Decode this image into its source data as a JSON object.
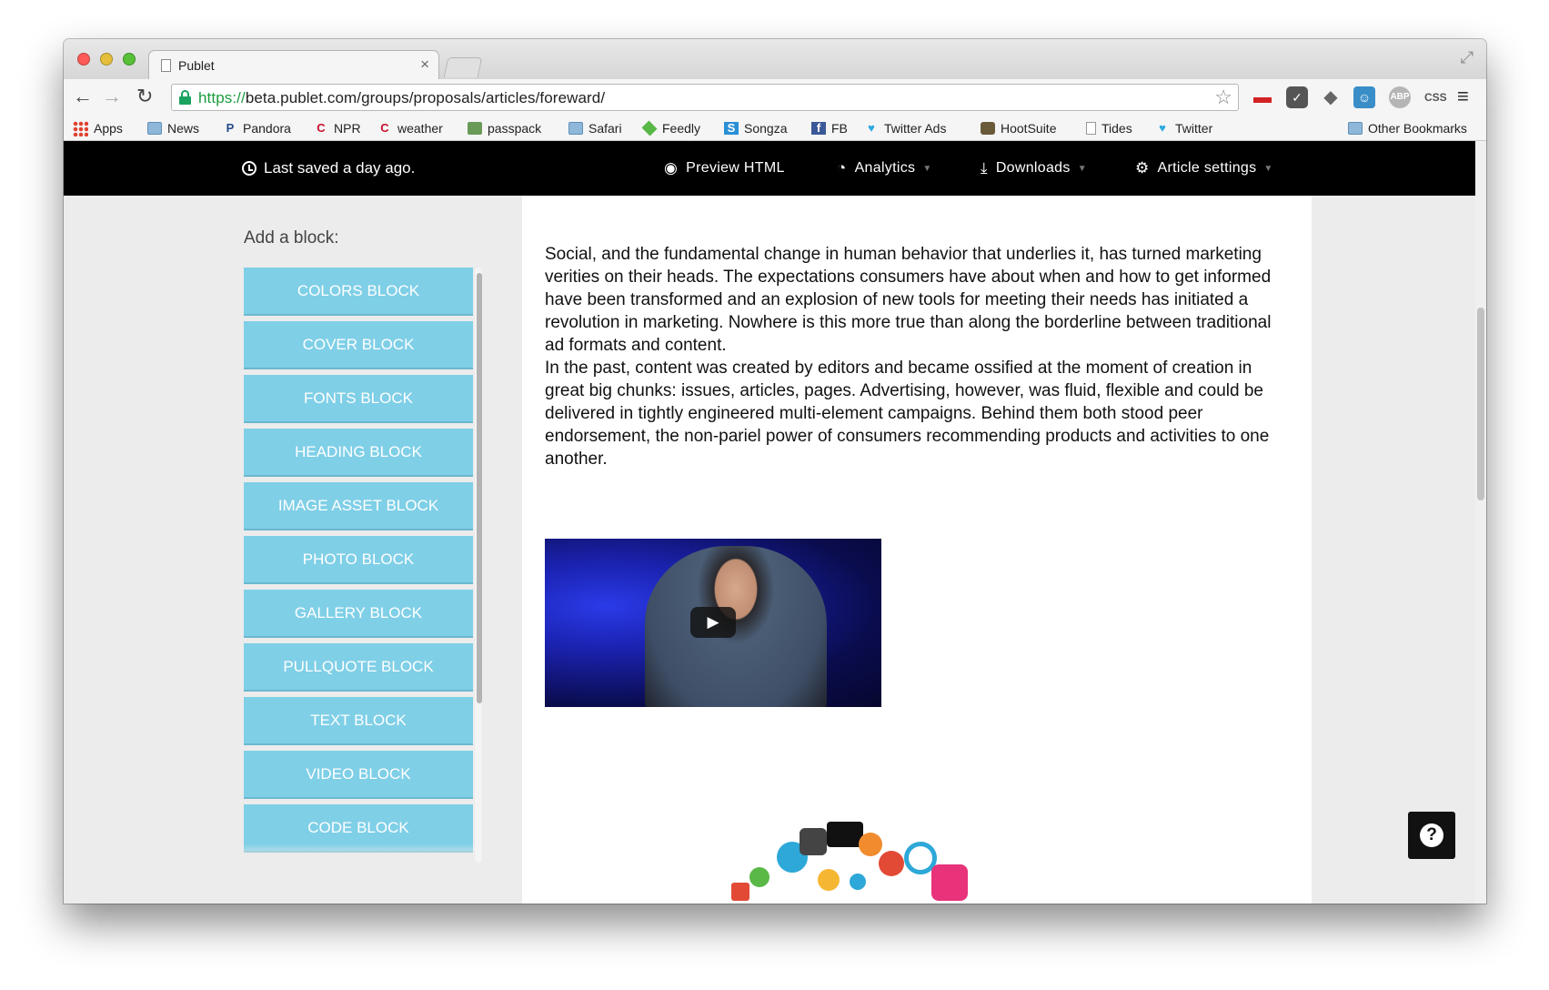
{
  "browser": {
    "tab": {
      "title": "Publet",
      "close": "×"
    },
    "url": {
      "scheme": "https://",
      "host_path": "beta.publet.com/groups/proposals/articles/foreward/"
    },
    "bookmarks": [
      {
        "label": "Apps",
        "icon": "apps-icon"
      },
      {
        "label": "News",
        "icon": "folder-icon"
      },
      {
        "label": "Pandora",
        "icon": "pandora-icon",
        "glyph": "P"
      },
      {
        "label": "NPR",
        "icon": "npr-icon",
        "glyph": "C"
      },
      {
        "label": "weather",
        "icon": "weather-icon",
        "glyph": "C"
      },
      {
        "label": "passpack",
        "icon": "passpack-icon"
      },
      {
        "label": "Safari",
        "icon": "folder-icon"
      },
      {
        "label": "Feedly",
        "icon": "feedly-icon"
      },
      {
        "label": "Songza",
        "icon": "songza-icon",
        "glyph": "S"
      },
      {
        "label": "FB",
        "icon": "facebook-icon",
        "glyph": "f"
      },
      {
        "label": "Twitter Ads",
        "icon": "twitter-icon"
      },
      {
        "label": "HootSuite",
        "icon": "hootsuite-icon"
      },
      {
        "label": "Tides",
        "icon": "page-icon"
      },
      {
        "label": "Twitter",
        "icon": "twitter-icon"
      },
      {
        "label": "Other Bookmarks",
        "icon": "folder-icon"
      }
    ],
    "extensions": {
      "ext5": "ABP",
      "ext6": "CSS"
    }
  },
  "app": {
    "save_status": "Last saved a day ago.",
    "menu": {
      "preview": "Preview HTML",
      "analytics": "Analytics",
      "downloads": "Downloads",
      "settings": "Article settings"
    },
    "sidebar": {
      "heading": "Add a block:",
      "blocks": [
        "COLORS BLOCK",
        "COVER BLOCK",
        "FONTS BLOCK",
        "HEADING BLOCK",
        "IMAGE ASSET BLOCK",
        "PHOTO BLOCK",
        "GALLERY BLOCK",
        "PULLQUOTE BLOCK",
        "TEXT BLOCK",
        "VIDEO BLOCK",
        "CODE BLOCK"
      ]
    },
    "article": {
      "paragraphs": [
        "Social, and the fundamental change in human behavior that underlies it, has turned marketing verities on their heads. The expectations consumers have about when and how to get informed have been transformed and an explosion of new tools for meeting their needs has initiated a revolution in marketing. Nowhere is this more true than along the borderline between traditional ad formats and content.",
        "In the past, content was created by editors and became ossified at the moment of creation in great big chunks: issues, articles, pages. Advertising, however, was fluid, flexible and could be delivered in tightly engineered multi-element campaigns. Behind them both stood peer endorsement, the non-pariel power of consumers recommending products and activities to one another."
      ]
    },
    "help_label": "?"
  },
  "colors": {
    "block_button": "#7fcfe7",
    "header_bg": "#000000",
    "sidebar_bg": "#ececec",
    "url_scheme": "#1a9c3e"
  }
}
